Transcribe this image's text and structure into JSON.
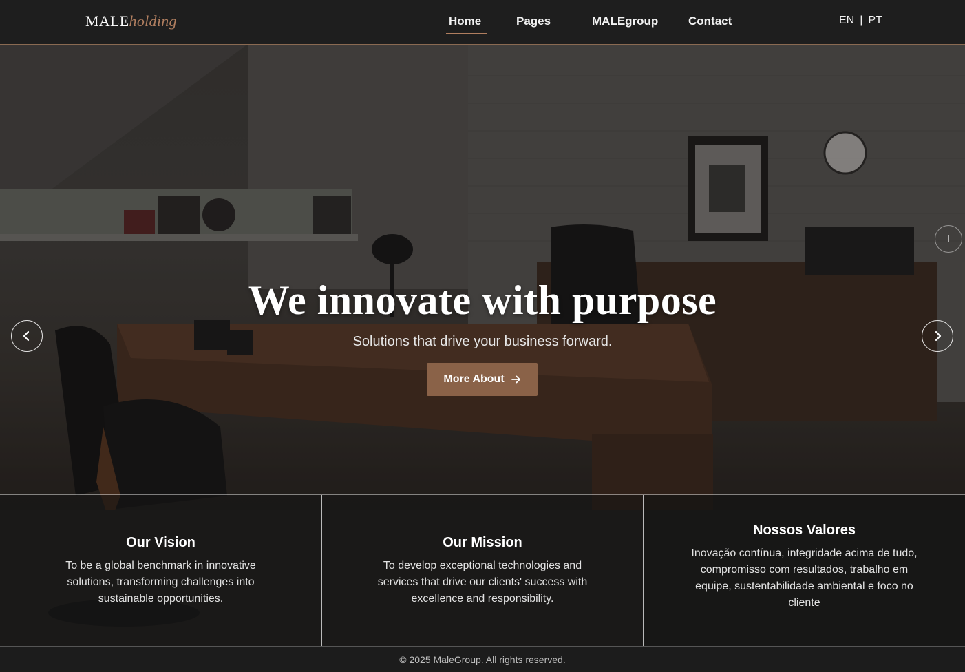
{
  "brand": {
    "name_main": "MALE",
    "name_sub": "holding"
  },
  "nav": {
    "items": [
      {
        "label": "Home",
        "active": true
      },
      {
        "label": "Pages",
        "active": false
      },
      {
        "label": "MALEgroup",
        "active": false
      },
      {
        "label": "Contact",
        "active": false
      }
    ],
    "languages": [
      "EN",
      "PT"
    ],
    "lang_separator": "|"
  },
  "hero": {
    "title": "We innovate with purpose",
    "subtitle": "Solutions that drive your business forward.",
    "cta_label": "More About",
    "cta_icon": "arrow-right-icon",
    "prev_icon": "chevron-left-icon",
    "next_icon": "chevron-right-icon"
  },
  "features": [
    {
      "title": "Our Vision",
      "text": "To be a global benchmark in innovative solutions, transforming challenges into sustainable opportunities."
    },
    {
      "title": "Our Mission",
      "text": "To develop exceptional technologies and services that drive our clients' success with excellence and responsibility."
    },
    {
      "title": "Nossos Valores",
      "text": "Inovação contínua, integridade acima de tudo, compromisso com resultados, trabalho em equipe, sustentabilidade ambiental e foco no cliente"
    }
  ],
  "footer": {
    "copyright": "© 2025 MaleGroup. All rights reserved."
  },
  "colors": {
    "accent": "#8a6248",
    "accent_light": "#b07e5f",
    "navbar_bg": "#1e1e1e"
  }
}
